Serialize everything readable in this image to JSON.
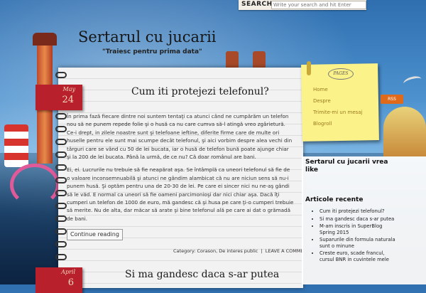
{
  "search": {
    "label": "SEARCH",
    "placeholder": "Write your search and hit Enter"
  },
  "site": {
    "title": "Sertarul cu jucarii",
    "tagline": "\"Traiesc pentru prima data\""
  },
  "posts": [
    {
      "month": "May",
      "day": "24",
      "title": "Cum iti protejezi telefonul?",
      "paragraphs": [
        "În prima fază fiecare dintre noi suntem tentaţi ca atunci când ne cumpărăm un telefon nou să ne punem repede folie şi o husă ca nu care cumva să-l atingă vreo zgârietură. Ce-i drept, in zilele noastre sunt şi telefoane ieftine, diferite firme care de multe ori huselle pentru ele sunt mai scumpe decât telefonul, şi aici vorbim despre alea vechi din târguri care se vând cu 50 de lei bucata, iar o husă de telefon bună poate ajunge chiar şi la 200 de lei bucata. Până la urmă, de ce nu? Că doar românul are bani.",
        "Ei, ei. Lucrurile nu trebuie să fie neapărat aşa. Se întâmplă ca uneori telefonul să fie de o valoare inconsemnuabilă şi atunci ne gândim alambicat că nu are niciun sens să nu-i punem husă. Şi optăm pentru una de 20-30 de lei. Pe care ei sincer nici nu ne-aş gândi să le văd. E normal ca uneori să fie oameni parcimonioşi dar nici chiar aşa. Dacă îţi cumperi un telefon de 1000 de euro, mă gandesc că şi husa pe care ţi-o cumperi trebuie să merite. Nu de alta, dar măcar să arate şi bine telefonul ală pe care ai dat o grămadă de bani."
      ],
      "continue_label": "Continue reading",
      "meta": {
        "category_label": "Category:",
        "categories": "Corason, De interes public",
        "separator": "|",
        "comment_link": "LEAVE A COMMENT"
      }
    },
    {
      "month": "April",
      "day": "6",
      "title": "Si ma gandesc daca s-ar putea"
    }
  ],
  "sticky": {
    "badge": "PAGES",
    "nav": [
      "Home",
      "Despre",
      "Trimite-mi un mesaj",
      "Blogroll"
    ]
  },
  "rss_label": "RSS",
  "sidebar": {
    "widget_title": "Sertarul cu jucarii vrea like",
    "recent_title": "Articole recente",
    "recent": [
      "Cum iti protejezi telefonul?",
      "Si ma gandesc daca s-ar putea",
      "M-am inscris in SuperBlog Spring 2015",
      "Suparurile din formula naturala sunt o minune",
      "Creste euro, scade francul, cursul BNR in cuvintele mele"
    ]
  },
  "colors": {
    "date_tab": "#b8202b",
    "sticky": "#fcf28a",
    "nav_link": "#9a7a20"
  }
}
